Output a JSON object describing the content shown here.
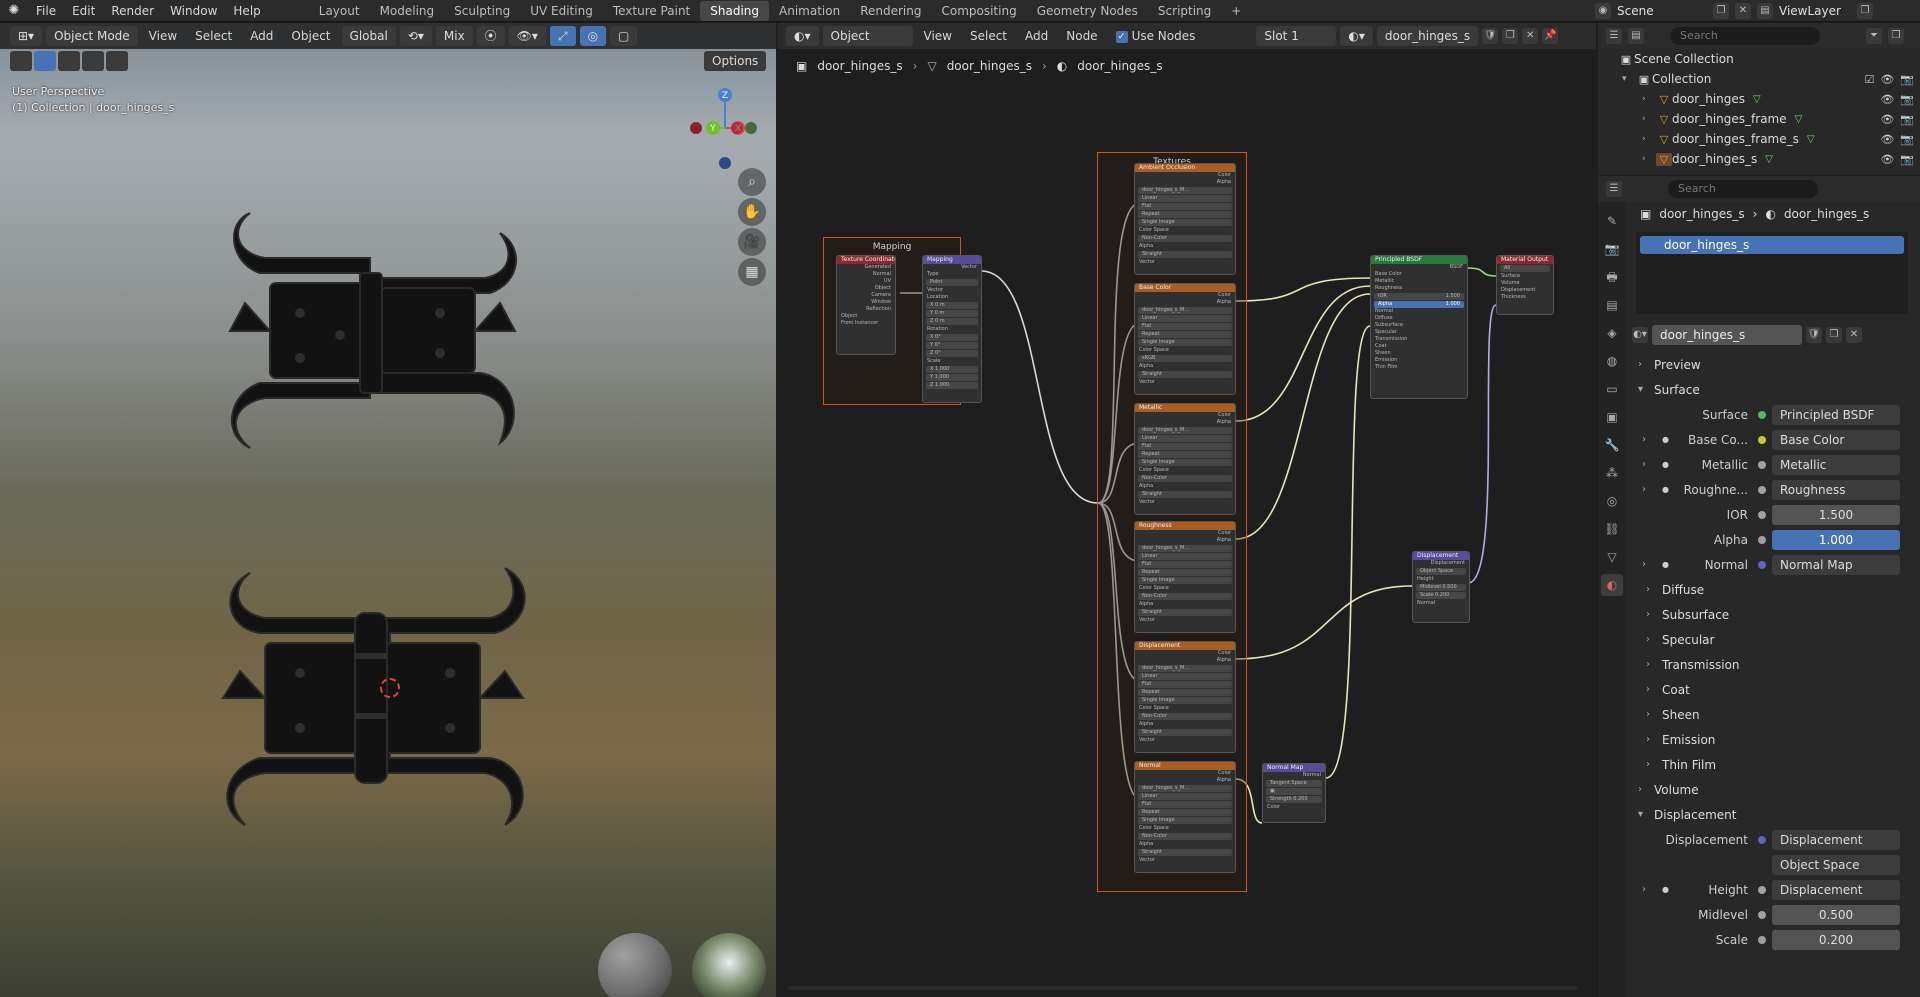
{
  "topbar": {
    "menus": [
      "File",
      "Edit",
      "Render",
      "Window",
      "Help"
    ],
    "workspaces": [
      "Layout",
      "Modeling",
      "Sculpting",
      "UV Editing",
      "Texture Paint",
      "Shading",
      "Animation",
      "Rendering",
      "Compositing",
      "Geometry Nodes",
      "Scripting"
    ],
    "active_workspace": "Shading",
    "add_tab": "+",
    "scene": "Scene",
    "view_layer": "ViewLayer"
  },
  "viewport": {
    "mode": "Object Mode",
    "menus": [
      "View",
      "Select",
      "Add",
      "Object"
    ],
    "orientation": "Global",
    "pivot": "Mix",
    "options": "Options",
    "perspective": "User Perspective",
    "collection_info": "(1) Collection | door_hinges_s",
    "gizmo": {
      "z": "Z",
      "y": "Y",
      "x": "X"
    }
  },
  "node_editor": {
    "type": "Object",
    "menus": [
      "View",
      "Select",
      "Add",
      "Node"
    ],
    "use_nodes_label": "Use Nodes",
    "slot": "Slot 1",
    "material": "door_hinges_s",
    "breadcrumb": [
      "door_hinges_s",
      "door_hinges_s",
      "door_hinges_s"
    ],
    "frames": {
      "mapping": "Mapping",
      "textures": "Textures"
    },
    "nodes": {
      "texcoord": {
        "title": "Texture Coordinate",
        "outputs": [
          "Generated",
          "Normal",
          "UV",
          "Object",
          "Camera",
          "Window",
          "Reflection"
        ],
        "object": "Object",
        "from_instancer": "From Instancer"
      },
      "mapping": {
        "title": "Mapping",
        "out": "Vector",
        "type_label": "Type",
        "type_value": "Point",
        "vector": "Vector",
        "location": "Location",
        "loc": [
          "X   0 m",
          "Y   0 m",
          "Z   0 m"
        ],
        "rotation": "Rotation",
        "rot": [
          "X   0°",
          "Y   0°",
          "Z   0°"
        ],
        "scale": "Scale",
        "scl": [
          "X   1.000",
          "Y   1.000",
          "Z   1.000"
        ]
      },
      "tex_titles": [
        "Ambient Occlusion",
        "Base Color",
        "Metallic",
        "Roughness",
        "Displacement",
        "Normal"
      ],
      "tex_common": {
        "color": "Color",
        "alpha": "Alpha",
        "image": "door_hinges_s_M...",
        "interp": "Linear",
        "proj": "Flat",
        "ext": "Repeat",
        "source": "Single Image",
        "cs_label": "Color Space",
        "cs_non": "Non-Color",
        "cs_srgb": "sRGB",
        "alpha_label": "Alpha",
        "alpha_val": "Straight",
        "vector": "Vector"
      },
      "bsdf": {
        "title": "Principled BSDF",
        "out": "BSDF",
        "rows": [
          "Base Color",
          "Metallic",
          "Roughness",
          "IOR",
          "Alpha",
          "Normal",
          "Diffuse",
          "Subsurface",
          "Specular",
          "Transmission",
          "Coat",
          "Sheen",
          "Emission",
          "Thin Film"
        ],
        "ior": "1.500",
        "alpha": "1.000"
      },
      "output": {
        "title": "Material Output",
        "target": "All",
        "inputs": [
          "Surface",
          "Volume",
          "Displacement",
          "Thickness"
        ]
      },
      "disp": {
        "title": "Displacement",
        "out": "Displacement",
        "space": "Object Space",
        "height": "Height",
        "midlevel": "Midlevel   0.500",
        "scale": "Scale   0.200",
        "normal": "Normal"
      },
      "normalmap": {
        "title": "Normal Map",
        "out": "Normal",
        "space": "Tangent Space",
        "strength": "Strength   0.200",
        "color": "Color"
      }
    }
  },
  "outliner": {
    "search_placeholder": "Search",
    "scene_collection": "Scene Collection",
    "collection": "Collection",
    "objects": [
      "door_hinges",
      "door_hinges_frame",
      "door_hinges_frame_s",
      "door_hinges_s"
    ]
  },
  "properties": {
    "search_placeholder": "Search",
    "crumbs": [
      "door_hinges_s",
      "door_hinges_s"
    ],
    "slot_name": "door_hinges_s",
    "material_name": "door_hinges_s",
    "sections": {
      "preview": "Preview",
      "surface": "Surface",
      "volume": "Volume",
      "displacement": "Displacement"
    },
    "surface_label": "Surface",
    "surface_value": "Principled BSDF",
    "base_color_label": "Base Co...",
    "base_color_value": "Base Color",
    "metallic_label": "Metallic",
    "metallic_value": "Metallic",
    "roughness_label": "Roughne...",
    "roughness_value": "Roughness",
    "ior_label": "IOR",
    "ior_value": "1.500",
    "alpha_label": "Alpha",
    "alpha_value": "1.000",
    "normal_label": "Normal",
    "normal_value": "Normal Map",
    "subpanels": [
      "Diffuse",
      "Subsurface",
      "Specular",
      "Transmission",
      "Coat",
      "Sheen",
      "Emission",
      "Thin Film"
    ],
    "disp_label": "Displacement",
    "disp_value": "Displacement",
    "disp_space": "Object Space",
    "height_label": "Height",
    "height_value": "Displacement",
    "midlevel_label": "Midlevel",
    "midlevel_value": "0.500",
    "scale_label": "Scale",
    "scale_value": "0.200"
  },
  "colors": {
    "accent": "#4772b3",
    "frame": "#d0541a",
    "texture_header": "#a85d22",
    "shader_header": "#287a3a",
    "vector_header": "#5a4a9c",
    "wire": "#e8e4c0"
  }
}
